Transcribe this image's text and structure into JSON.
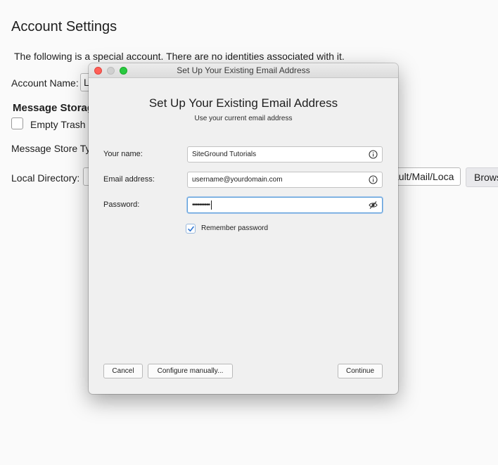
{
  "background": {
    "title": "Account Settings",
    "note": "The following is a special account. There are no identities associated with it.",
    "account_name_label": "Account Name:",
    "account_name_value": "L",
    "message_storage_label": "Message Storag",
    "empty_trash_label": "Empty Trash",
    "message_store_type_label": "Message Store Ty",
    "local_directory_label": "Local Directory:",
    "local_directory_value": "ault/Mail/Loca",
    "browse_label": "Brows"
  },
  "dialog": {
    "window_title": "Set Up Your Existing Email Address",
    "heading": "Set Up Your Existing Email Address",
    "subheading": "Use your current email address",
    "fields": {
      "name": {
        "label": "Your name:",
        "value": "SiteGround Tutorials",
        "icon": "info-icon"
      },
      "email": {
        "label": "Email address:",
        "value": "username@yourdomain.com",
        "icon": "info-icon"
      },
      "password": {
        "label": "Password:",
        "value": "••••••••••",
        "icon": "eye-slash-icon"
      }
    },
    "remember_password": {
      "label": "Remember password",
      "checked": true
    },
    "buttons": {
      "cancel": "Cancel",
      "configure": "Configure manually...",
      "continue": "Continue"
    }
  },
  "colors": {
    "close": "#ff5f57",
    "minimize": "#d0d0d0",
    "zoom": "#28c940",
    "focus": "#5b9dd9",
    "check": "#2f76d2"
  }
}
